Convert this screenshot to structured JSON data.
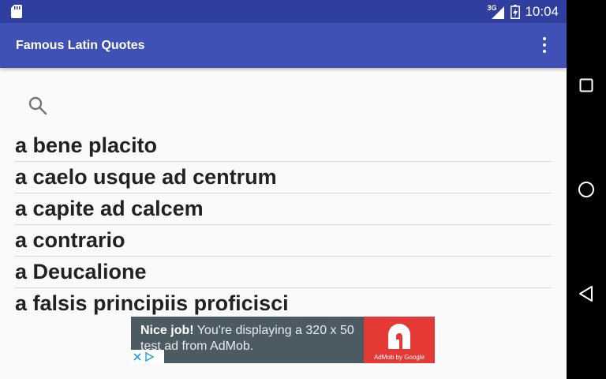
{
  "status_bar": {
    "network": "3G",
    "time": "10:04"
  },
  "app_bar": {
    "title": "Famous Latin Quotes"
  },
  "quotes": [
    "a bene placito",
    "a caelo usque ad centrum",
    "a capite ad calcem",
    "a contrario",
    "a Deucalione",
    "a falsis principiis proficisci"
  ],
  "ad": {
    "headline": "Nice job!",
    "body": " You're displaying a 320 x 50 test ad from AdMob.",
    "logo_caption": "AdMob by Google"
  },
  "colors": {
    "status_bar": "#303f9f",
    "app_bar": "#3f51b5",
    "ad_bg": "#4c5a63",
    "ad_logo": "#e53935"
  },
  "icons": {
    "status": [
      "sd-card-icon",
      "signal-icon",
      "battery-icon"
    ],
    "app_bar": [
      "overflow-menu-icon"
    ],
    "content": [
      "search-icon"
    ],
    "nav": [
      "recents-icon",
      "home-icon",
      "back-icon"
    ]
  }
}
